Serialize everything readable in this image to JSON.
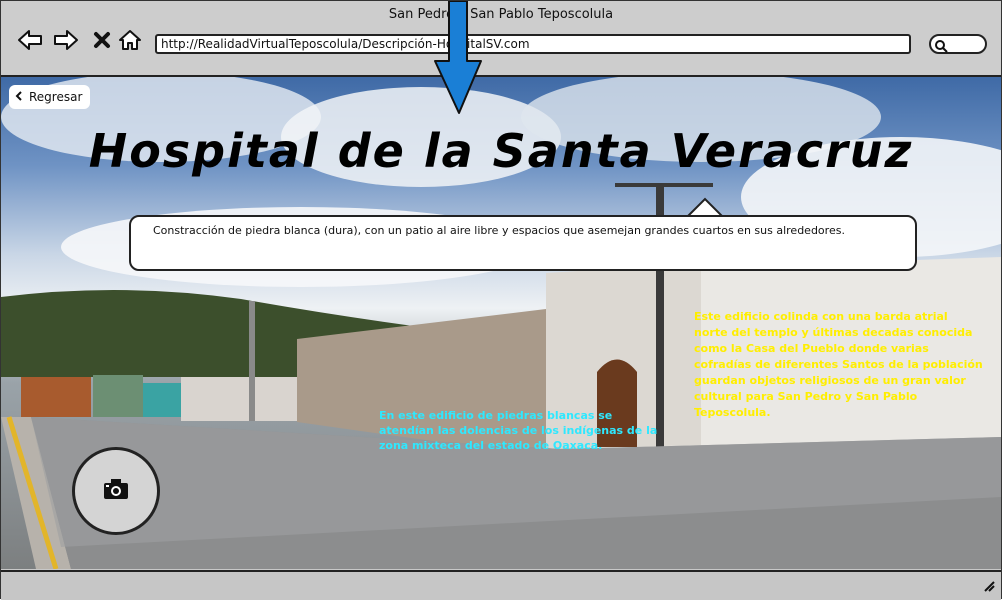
{
  "window": {
    "title": "San Pedro y San Pablo Teposcolula",
    "url": "http://RealidadVirtualTeposcolula/Descripción-HospitalSV.com"
  },
  "toolbar": {
    "back_icon": "arrow-left-icon",
    "forward_icon": "arrow-right-icon",
    "stop_icon": "close-icon",
    "home_icon": "home-icon",
    "search_icon": "search-icon"
  },
  "page": {
    "back_button_label": "Regresar",
    "title": "Hospital de la Santa Veracruz",
    "callout_text": "Constracción de piedra blanca (dura), con un patio al aire libre y espacios que asemejan grandes cuartos en sus alrededores.",
    "note_yellow": "Este edificio colinda con una barda atrial norte del templo y últimas decadas conocida como la Casa del Pueblo donde varias cofradías de diferentes Santos de la población guardan objetos religiosos de un gran valor cultural para San Pedro y San Pablo Teposcolula.",
    "note_cyan": "En este edificio de piedras blancas se atendían las dolencias de los indígenas de la zona mixteca del estado de Oaxaca.",
    "camera_icon": "camera-icon"
  },
  "colors": {
    "yellow_text": "#ffee00",
    "cyan_text": "#2ee8ff",
    "arrow": "#1a7fd6"
  }
}
